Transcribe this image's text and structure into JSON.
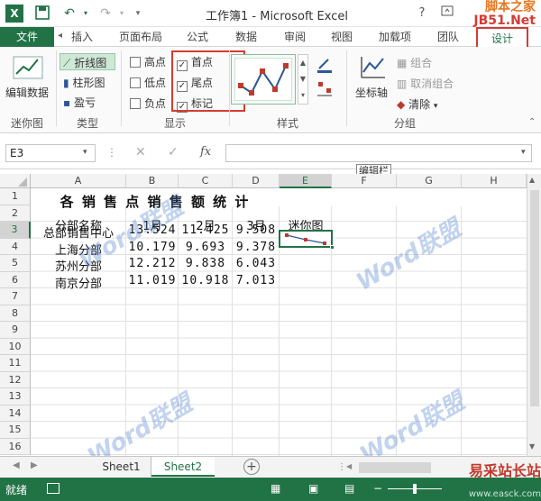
{
  "titlebar": {
    "title": "工作簿1 - Microsoft Excel",
    "help": "?",
    "watermark_line1": "脚本之家",
    "watermark_line2": "JB51.Net"
  },
  "tabs": [
    "文件",
    "插入",
    "页面布局",
    "公式",
    "数据",
    "审阅",
    "视图",
    "加载项",
    "团队",
    "设计"
  ],
  "ribbon": {
    "sparkline_group": {
      "edit_data": "编辑数据",
      "label": "迷你图"
    },
    "type_group": {
      "line": "折线图",
      "column": "柱形图",
      "winloss": "盈亏",
      "label": "类型"
    },
    "show_group": {
      "high_point": "高点",
      "low_point": "低点",
      "negative_point": "负点",
      "first_point": "首点",
      "last_point": "尾点",
      "markers": "标记",
      "label": "显示"
    },
    "style_group": {
      "label": "样式"
    },
    "group_group": {
      "axis": "坐标轴",
      "group": "组合",
      "ungroup": "取消组合",
      "clear": "清除",
      "label": "分组"
    }
  },
  "formulabar": {
    "namebox": "E3",
    "fx": "fx"
  },
  "tooltip": "编辑栏",
  "columns": [
    "A",
    "B",
    "C",
    "D",
    "E",
    "F",
    "G",
    "H"
  ],
  "rows": [
    "1",
    "2",
    "3",
    "4",
    "5",
    "6",
    "7",
    "8",
    "9",
    "10",
    "11",
    "12",
    "13",
    "14",
    "15",
    "16"
  ],
  "sheet": {
    "title": "各 销 售 点 销 售 额 统 计",
    "headers": [
      "分部名称",
      "1月",
      "2月",
      "3月",
      "迷你图"
    ],
    "data": [
      [
        "总部销售中心",
        "13.524",
        "11.425",
        "9.508"
      ],
      [
        "上海分部",
        "10.179",
        "9.693",
        "9.378"
      ],
      [
        "苏州分部",
        "12.212",
        "9.838",
        "6.043"
      ],
      [
        "南京分部",
        "11.019",
        "10.918",
        "7.013"
      ]
    ]
  },
  "sheettabs": [
    "Sheet1",
    "Sheet2"
  ],
  "status": {
    "ready": "就绪"
  },
  "watermarks": {
    "word_logo": "Word联盟",
    "bottom_site": "易采站长站",
    "bottom_url": "www.easck.com"
  },
  "colors": {
    "excel_green": "#217346",
    "highlight_red": "#d53c33"
  }
}
